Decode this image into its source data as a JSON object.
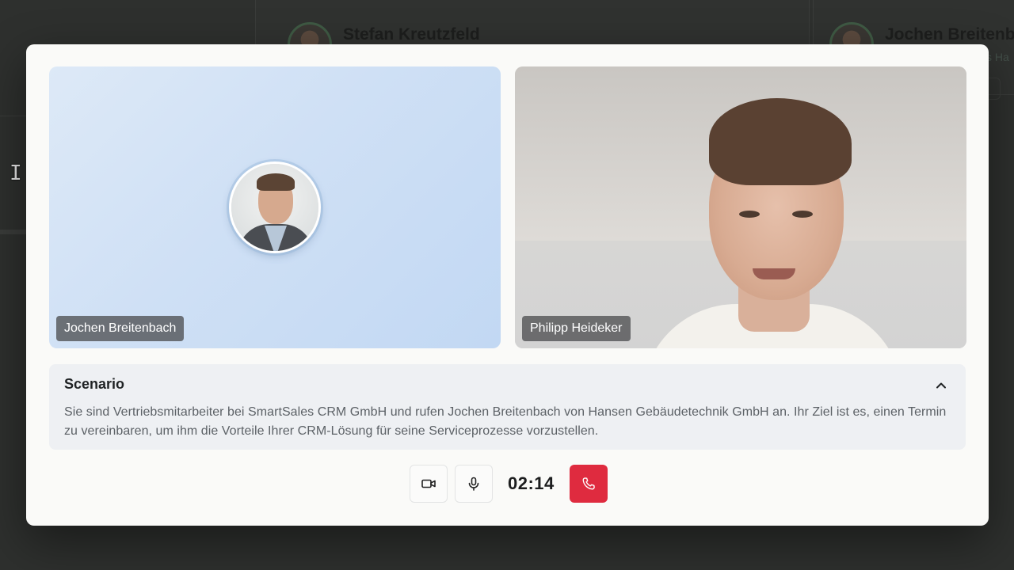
{
  "background": {
    "cards": [
      {
        "name": "Stefan Kreutzfeld"
      },
      {
        "name": "Jochen Breitenb",
        "subtitle": "s Ha"
      }
    ]
  },
  "call": {
    "participants": [
      {
        "name": "Jochen Breitenbach",
        "video": false
      },
      {
        "name": "Philipp Heideker",
        "video": true
      }
    ],
    "scenario": {
      "title": "Scenario",
      "text": "Sie sind Vertriebsmitarbeiter bei SmartSales CRM GmbH und rufen Jochen Breitenbach von Hansen Gebäudetechnik GmbH an. Ihr Ziel ist es, einen Termin zu vereinbaren, um ihm die Vorteile Ihrer CRM-Lösung für seine Serviceprozesse vorzustellen.",
      "collapse_icon": "chevron-up-icon"
    },
    "controls": {
      "camera_icon": "video-camera-icon",
      "mic_icon": "microphone-icon",
      "timer": "02:14",
      "end_icon": "phone-icon",
      "end_color": "#df2b3f"
    }
  }
}
